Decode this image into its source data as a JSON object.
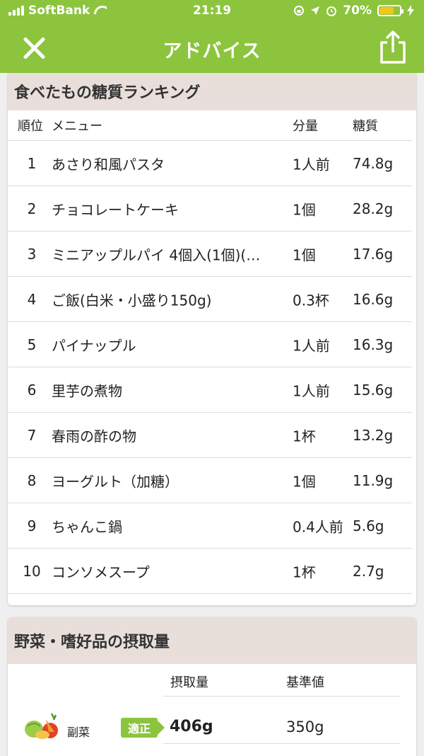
{
  "status": {
    "carrier": "SoftBank",
    "time": "21:19",
    "battery": "70%"
  },
  "nav": {
    "title": "アドバイス"
  },
  "ranking": {
    "title": "食べたもの糖質ランキング",
    "headers": {
      "rank": "順位",
      "menu": "メニュー",
      "amount": "分量",
      "sugar": "糖質"
    },
    "rows": [
      {
        "rank": "1",
        "menu": "あさり和風パスタ",
        "amount": "1人前",
        "sugar": "74.8g"
      },
      {
        "rank": "2",
        "menu": "チョコレートケーキ",
        "amount": "1個",
        "sugar": "28.2g"
      },
      {
        "rank": "3",
        "menu": "ミニアップルパイ 4個入(1個)(…",
        "amount": "1個",
        "sugar": "17.6g"
      },
      {
        "rank": "4",
        "menu": "ご飯(白米・小盛り150g)",
        "amount": "0.3杯",
        "sugar": "16.6g"
      },
      {
        "rank": "5",
        "menu": "パイナップル",
        "amount": "1人前",
        "sugar": "16.3g"
      },
      {
        "rank": "6",
        "menu": "里芋の煮物",
        "amount": "1人前",
        "sugar": "15.6g"
      },
      {
        "rank": "7",
        "menu": "春雨の酢の物",
        "amount": "1杯",
        "sugar": "13.2g"
      },
      {
        "rank": "8",
        "menu": "ヨーグルト（加糖）",
        "amount": "1個",
        "sugar": "11.9g"
      },
      {
        "rank": "9",
        "menu": "ちゃんこ鍋",
        "amount": "0.4人前",
        "sugar": "5.6g"
      },
      {
        "rank": "10",
        "menu": "コンソメスープ",
        "amount": "1杯",
        "sugar": "2.7g"
      }
    ]
  },
  "intake": {
    "title": "野菜・嗜好品の摂取量",
    "headers": {
      "intake": "摂取量",
      "standard": "基準値"
    },
    "rows": [
      {
        "label": "副菜",
        "status": "適正",
        "value": "406g",
        "standard": "350g"
      }
    ]
  },
  "colors": {
    "accent": "#8cc43e",
    "section_header": "#e8dfdb"
  }
}
